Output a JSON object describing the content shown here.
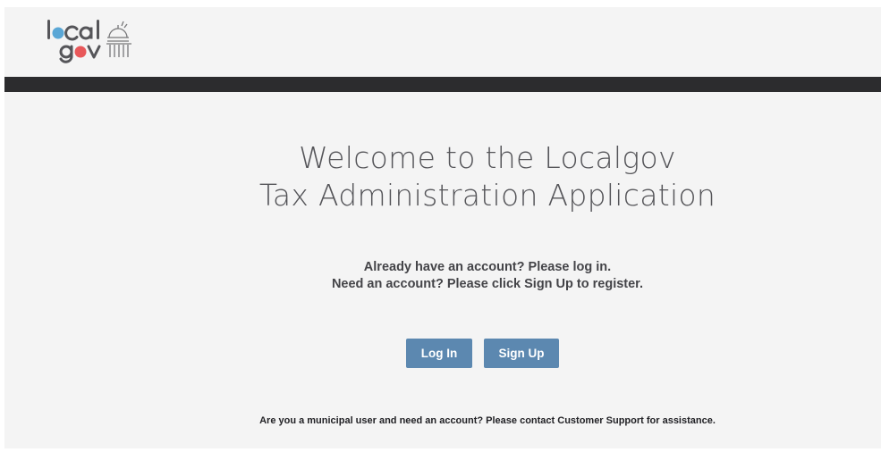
{
  "brand": {
    "logo_word_top": "local",
    "logo_word_bottom": "gov",
    "dot_blue": "#5aa7d6",
    "dot_red": "#e8585a",
    "ink": "#555559"
  },
  "main": {
    "title_line1": "Welcome to the Localgov",
    "title_line2": "Tax Administration Application",
    "info_line1": "Already have an account? Please log in.",
    "info_line2": "Need an account? Please click Sign Up to register."
  },
  "actions": {
    "login_label": "Log In",
    "signup_label": "Sign Up",
    "button_color": "#5c88b0"
  },
  "footer": {
    "municipal_note": "Are you a municipal user and need an account? Please contact Customer Support for assistance."
  }
}
